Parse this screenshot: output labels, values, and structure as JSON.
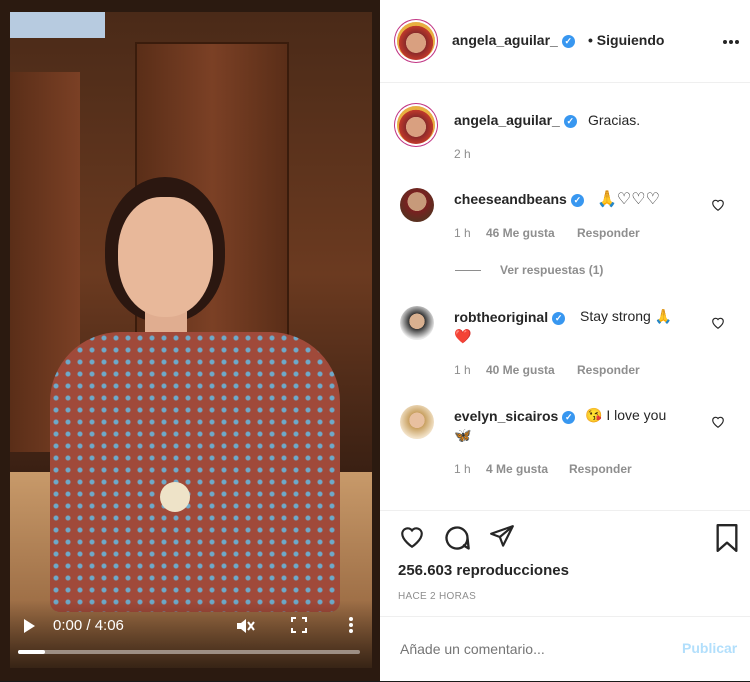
{
  "video": {
    "time": "0:00 / 4:06",
    "progress": 0.08,
    "icons": [
      "play-icon",
      "mute-icon",
      "fullscreen-icon",
      "more-vertical-icon"
    ]
  },
  "post": {
    "author": "angela_aguilar_",
    "follow_status": "• Siguiendo",
    "caption": "Gracias.",
    "caption_time": "2 h",
    "comments": [
      {
        "user": "cheeseandbeans",
        "text": "🙏♡♡♡",
        "time": "1 h",
        "likes": "46 Me gusta",
        "reply": "Responder",
        "view_replies": "Ver respuestas (1)"
      },
      {
        "user": "robtheoriginal",
        "text": "Stay strong 🙏",
        "text2": "❤️",
        "time": "1 h",
        "likes": "40 Me gusta",
        "reply": "Responder"
      },
      {
        "user": "evelyn_sicairos",
        "text": "😘 I love you",
        "text2": "🦋",
        "time": "1 h",
        "likes": "4 Me gusta",
        "reply": "Responder"
      }
    ],
    "views": "256.603 reproducciones",
    "posted": "HACE 2 HORAS",
    "comment_placeholder": "Añade un comentario...",
    "publish": "Publicar"
  },
  "colors": {
    "verified": "#3897f0",
    "publish_disabled": "#b2dffc",
    "heart_red": "#ed4956"
  }
}
